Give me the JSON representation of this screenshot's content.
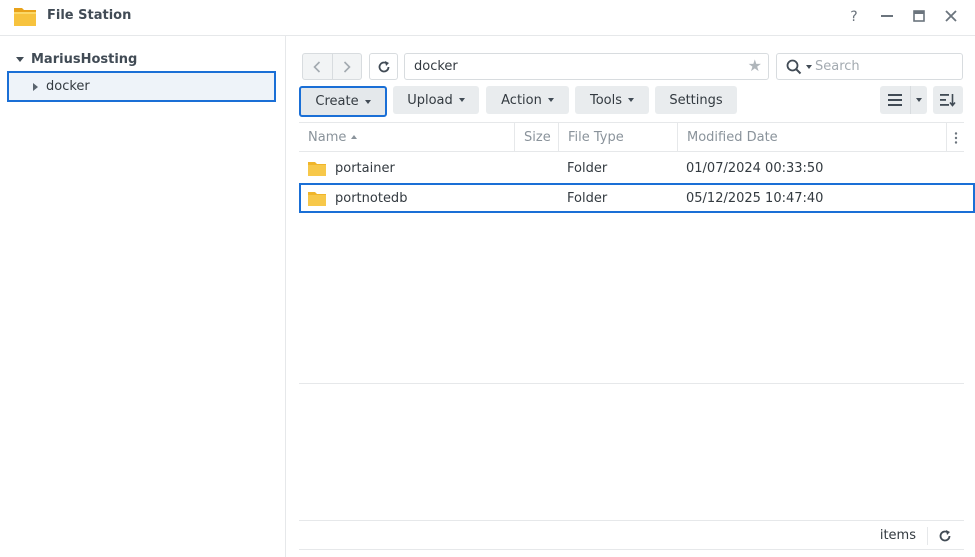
{
  "window": {
    "title": "File Station",
    "help_symbol": "?",
    "minimize_symbol": "—",
    "close_symbol": "✕"
  },
  "tree": {
    "root_label": "MariusHosting",
    "items": [
      {
        "label": "docker",
        "selected": true
      }
    ]
  },
  "path_bar": {
    "path": "docker"
  },
  "search": {
    "placeholder": "Search"
  },
  "toolbar": {
    "create": "Create",
    "upload": "Upload",
    "action": "Action",
    "tools": "Tools",
    "settings": "Settings"
  },
  "columns": {
    "name": "Name",
    "size": "Size",
    "file_type": "File Type",
    "modified_date": "Modified Date"
  },
  "files": [
    {
      "name": "portainer",
      "size": "",
      "type": "Folder",
      "modified": "01/07/2024 00:33:50",
      "selected": false
    },
    {
      "name": "portnotedb",
      "size": "",
      "type": "Folder",
      "modified": "05/12/2025 10:47:40",
      "selected": true
    }
  ],
  "status": {
    "items_label": "items"
  },
  "colors": {
    "accent": "#1a6fd6",
    "folder": "#f5c33b",
    "button_bg": "#e9ecee"
  }
}
